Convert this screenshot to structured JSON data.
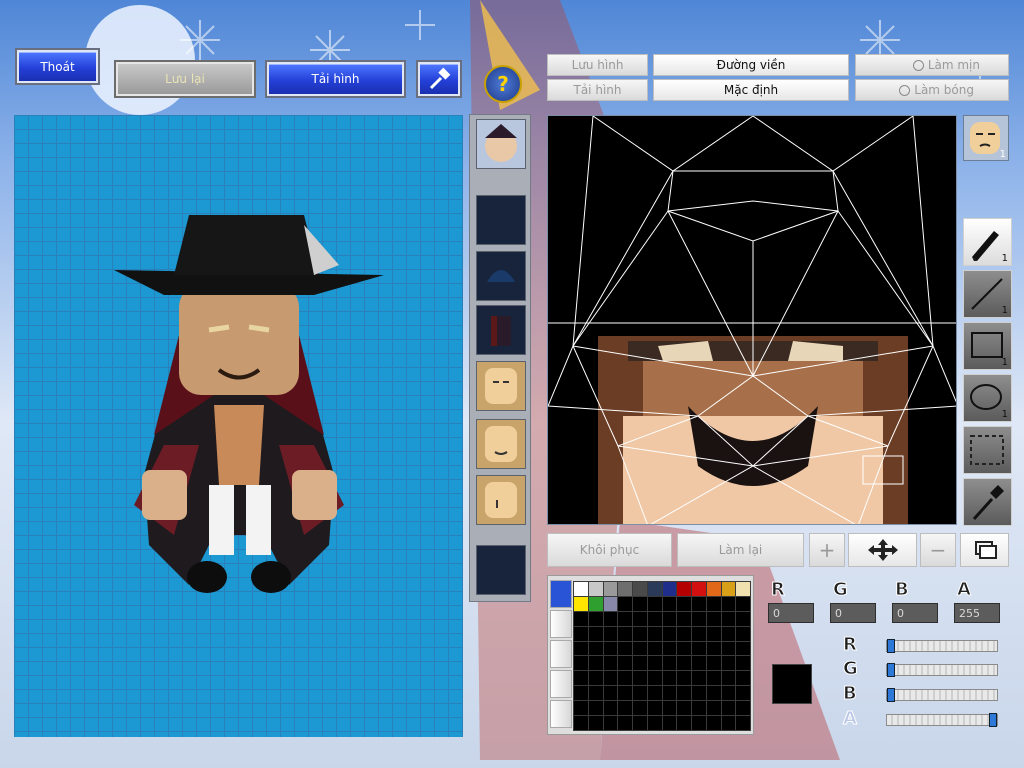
{
  "top_buttons": {
    "exit": "Thoát",
    "save": "Lưu lại",
    "load": "Tải hình"
  },
  "editor_buttons": {
    "save_image": "Lưu hình",
    "load_image": "Tải hình",
    "outline": "Đường viền",
    "default": "Mặc định",
    "smooth": "Làm mịn",
    "shade": "Làm bóng"
  },
  "bottom_buttons": {
    "restore": "Khôi phục",
    "redo": "Làm lại"
  },
  "tools": [
    {
      "name": "pen-tool",
      "count": "1"
    },
    {
      "name": "line-tool",
      "count": "1"
    },
    {
      "name": "rectangle-tool",
      "count": "1"
    },
    {
      "name": "ellipse-tool",
      "count": "1"
    },
    {
      "name": "select-tool",
      "count": ""
    },
    {
      "name": "eyedropper-tool",
      "count": ""
    }
  ],
  "face_icon_count": "1",
  "color": {
    "r": "0",
    "g": "0",
    "b": "0",
    "a": "255",
    "current_hex": "#000000",
    "r_label": "R",
    "g_label": "G",
    "b_label": "B",
    "a_label": "A",
    "r_level": 0,
    "g_level": 0,
    "b_level": 0,
    "a_level": 1
  },
  "palette_colors": [
    "#ffffff",
    "#c8c8c8",
    "#9a9a9a",
    "#6e6e6e",
    "#4a4a4a",
    "#2c3a5a",
    "#1e2e8a",
    "#b40000",
    "#d21010",
    "#e06818",
    "#d8a018",
    "#f0e0b0",
    "#ffe500",
    "#2fa02f",
    "#8888aa"
  ],
  "icons": {
    "help": "help-icon",
    "hammer": "hammer-icon",
    "move": "move-arrows-icon",
    "layers": "layers-icon"
  }
}
